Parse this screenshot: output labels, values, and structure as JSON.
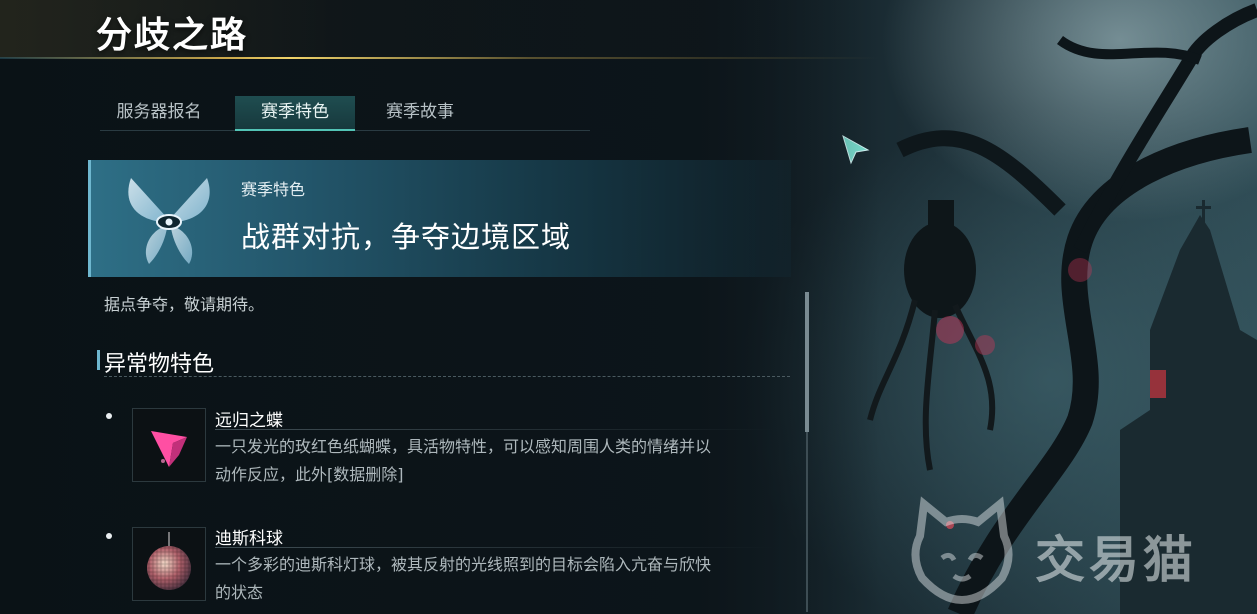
{
  "header": {
    "title": "分歧之路"
  },
  "tabs": [
    {
      "label": "服务器报名"
    },
    {
      "label": "赛季特色"
    },
    {
      "label": "赛季故事"
    }
  ],
  "active_tab": "赛季特色",
  "banner": {
    "kicker": "赛季特色",
    "headline": "战群对抗，争夺边境区域",
    "note": "据点争夺，敬请期待。"
  },
  "section": {
    "title": "异常物特色",
    "items": [
      {
        "name": "远归之蝶",
        "desc_line1": "一只发光的玫红色纸蝴蝶，具活物特性，可以感知周围人类的情绪并以",
        "desc_line2": "动作反应，此外[数据删除]",
        "icon": "pink-paper-butterfly-icon"
      },
      {
        "name": "迪斯科球",
        "desc_line1": "一个多彩的迪斯科灯球，被其反射的光线照到的目标会陷入亢奋与欣快",
        "desc_line2": "的状态",
        "icon": "disco-ball-icon"
      }
    ]
  },
  "watermark": {
    "text": "交易猫",
    "icon": "cat-face-icon"
  },
  "colors": {
    "accent_teal": "#53c4b6",
    "gold_line": "#f0d36a",
    "banner_blue": "#2e6f86",
    "butterfly_pink": "#ff4fa3"
  }
}
